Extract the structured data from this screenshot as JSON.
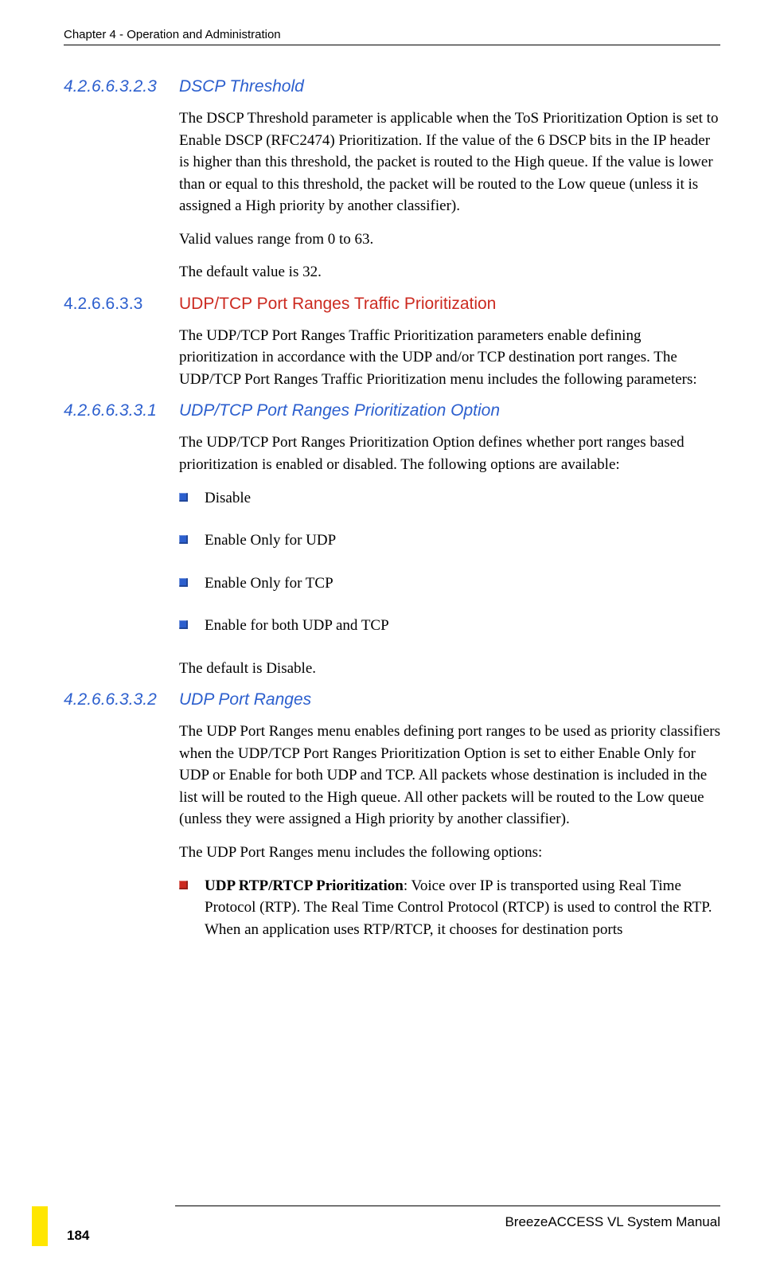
{
  "header": {
    "chapter": "Chapter 4 - Operation and Administration"
  },
  "s1": {
    "num": "4.2.6.6.3.2.3",
    "title": "DSCP Threshold",
    "p1": "The DSCP Threshold parameter is applicable when the ToS Prioritization Option is set to Enable DSCP (RFC2474) Prioritization. If the value of the 6 DSCP bits in the IP header is higher than this threshold, the packet is routed to the High queue. If the value is lower than or equal to this threshold, the packet will be routed to the Low queue (unless it is assigned a High priority by another classifier).",
    "p2": "Valid values range from 0 to 63.",
    "p3": "The default value is 32."
  },
  "s2": {
    "num": "4.2.6.6.3.3",
    "title": "UDP/TCP Port Ranges Traffic Prioritization",
    "p1": "The UDP/TCP Port Ranges Traffic Prioritization parameters enable defining prioritization in accordance with the UDP and/or TCP destination port ranges. The UDP/TCP Port Ranges Traffic Prioritization menu includes the following parameters:"
  },
  "s3": {
    "num": "4.2.6.6.3.3.1",
    "title": "UDP/TCP Port Ranges Prioritization Option",
    "p1": "The UDP/TCP Port Ranges Prioritization Option defines whether port ranges based prioritization is enabled or disabled. The following options are available:",
    "b1": "Disable",
    "b2": "Enable Only for UDP",
    "b3": "Enable Only for TCP",
    "b4": "Enable for both UDP and TCP",
    "p2": "The default is Disable."
  },
  "s4": {
    "num": "4.2.6.6.3.3.2",
    "title": "UDP Port Ranges",
    "p1": "The UDP Port Ranges menu enables defining port ranges to be used as priority classifiers when the UDP/TCP Port Ranges Prioritization Option is set to either Enable Only for UDP or Enable for both UDP and TCP. All packets whose destination is included in the list will be routed to the High queue. All other packets will be routed to the Low queue (unless they were assigned a High priority by another classifier).",
    "p2": "The UDP Port Ranges menu includes the following options:",
    "b1_bold": "UDP RTP/RTCP Prioritization",
    "b1_rest": ": Voice over IP is transported using Real Time Protocol (RTP). The Real Time Control Protocol (RTCP) is used to control the RTP. When an application uses RTP/RTCP, it chooses for destination ports"
  },
  "footer": {
    "manual": "BreezeACCESS VL System Manual",
    "page": "184"
  }
}
